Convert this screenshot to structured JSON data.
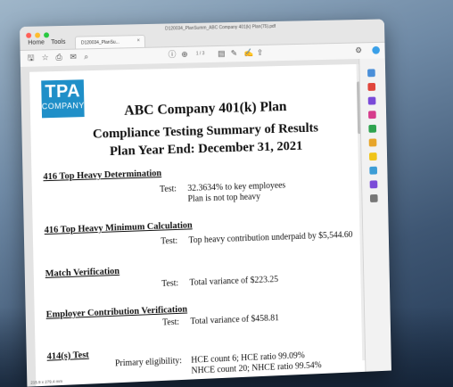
{
  "window": {
    "title": "D120034_PlanSumm_ABC Company 401(k) Plan(75).pdf",
    "nav": {
      "home": "Home",
      "tools": "Tools"
    },
    "tab_label": "D120034_PlanSu...",
    "tab_close": "×"
  },
  "toolbar": {
    "page_indicator": "1 / 3",
    "icons": [
      "save-icon",
      "star-icon",
      "print-icon",
      "mail-icon",
      "zoom-icon",
      "help-icon",
      "download-icon",
      "comment-icon",
      "pen-icon",
      "sign-icon",
      "share-icon"
    ]
  },
  "document": {
    "logo_main": "TPA",
    "logo_sub": "COMPANY",
    "title1": "ABC Company 401(k) Plan",
    "title2": "Compliance Testing Summary of Results",
    "title3": "Plan Year End: December 31, 2021",
    "sections": [
      {
        "heading": "416 Top Heavy Determination",
        "label": "Test:",
        "lines": [
          "32.3634% to key employees",
          "Plan is not top heavy"
        ]
      },
      {
        "heading": "416 Top Heavy Minimum Calculation",
        "label": "Test:",
        "lines": [
          "Top heavy contribution underpaid by $5,544.60"
        ]
      },
      {
        "heading": "Match Verification",
        "label": "Test:",
        "lines": [
          "Total variance of $223.25"
        ]
      },
      {
        "heading": "Employer Contribution Verification",
        "label": "Test:",
        "lines": [
          "Total variance of $458.81"
        ]
      },
      {
        "heading": "414(s) Test",
        "label": "Primary eligibility:",
        "lines": [
          "HCE count 6; HCE ratio 99.09%",
          "NHCE count 20; NHCE ratio 99.54%"
        ]
      }
    ]
  },
  "status": {
    "page_size": "215.9 x 279.4 mm"
  },
  "rail_colors": [
    "#4a8fd8",
    "#e0463c",
    "#7a4ad8",
    "#d63c8c",
    "#2fa34f",
    "#e7a52a",
    "#f0c419",
    "#3c9dd6",
    "#777777"
  ]
}
